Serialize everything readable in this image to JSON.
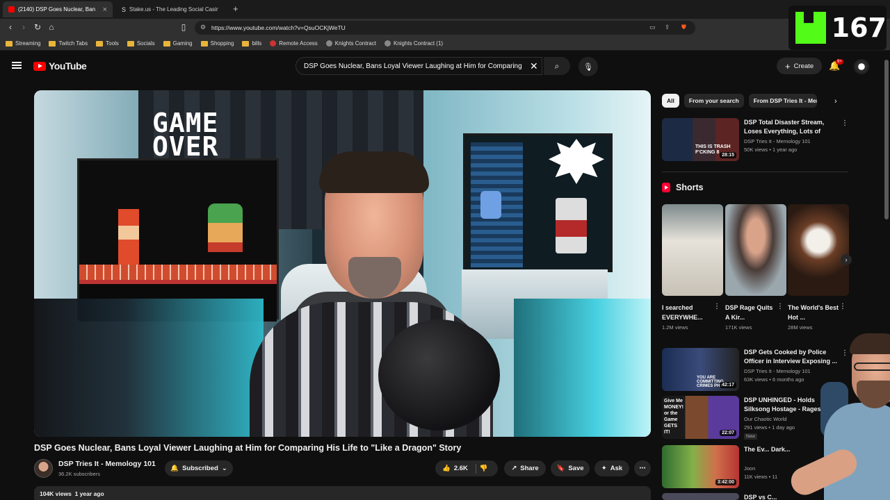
{
  "browser": {
    "tabs": [
      {
        "label": "(2140) DSP Goes Nuclear, Ban",
        "active": true
      },
      {
        "label": "Stake.us - The Leading Social Casino",
        "active": false
      }
    ],
    "url": "https://www.youtube.com/watch?v=QsuOCKjWeTU",
    "bookmarks": [
      "Streaming",
      "Twitch Tabs",
      "Tools",
      "Socials",
      "Gaming",
      "Shopping",
      "bills",
      "Remote Access",
      "Knights Contract",
      "Knights Contract (1)"
    ]
  },
  "kick_overlay": {
    "count": "167"
  },
  "header": {
    "logo_text": "YouTube",
    "search_query": "DSP Goes Nuclear, Bans Loyal Viewer Laughing at Him for Comparing",
    "create_label": "Create",
    "notif_badge": "9+"
  },
  "video": {
    "thumbnail_text": "GAME\nOVER",
    "title": "DSP Goes Nuclear, Bans Loyal Viewer Laughing at Him for Comparing His Life to \"Like a Dragon\" Story",
    "channel": "DSP Tries It - Memology 101",
    "subscribers": "36.2K subscribers",
    "subscribed_label": "Subscribed",
    "likes": "2.6K",
    "share_label": "Share",
    "save_label": "Save",
    "ask_label": "Ask",
    "views": "104K views",
    "age": "1 year ago"
  },
  "chips": [
    "All",
    "From your search",
    "From DSP Tries It - Mem"
  ],
  "recommendations_top": [
    {
      "title": "DSP Total Disaster Stream, Loses Everything, Lots of Troll...",
      "channel": "DSP Tries It - Memology 101",
      "meta": "50K views • 1 year ago",
      "duration": "28:15",
      "thumb_text": "THIS IS TRASH F'CKING 8"
    }
  ],
  "shorts": {
    "heading": "Shorts",
    "items": [
      {
        "title": "I searched EVERYWHE...",
        "views": "1.2M views"
      },
      {
        "title": "DSP Rage Quits A Kir...",
        "views": "171K views"
      },
      {
        "title": "The World's Best Hot ...",
        "views": "28M views"
      }
    ]
  },
  "recommendations": [
    {
      "title": "DSP Gets Cooked by Police Officer in Interview Exposing ...",
      "channel": "DSP Tries It - Memology 101",
      "meta": "63K views • 6 months ago",
      "duration": "42:17",
      "badge": "",
      "thumb_text": "YOU ARE COMMITTING CRIMES PHIL"
    },
    {
      "title": "DSP UNHINGED - Holds Silksong Hostage - Rages, B...",
      "channel": "Our Chaotic World",
      "meta": "291 views • 1 day ago",
      "duration": "22:07",
      "badge": "New",
      "thumb_text": "Give Me MONEY! or the Game GETS IT!"
    },
    {
      "title": "The Ev... Dark...",
      "channel": "Joon",
      "meta": "11K views • 11",
      "duration": "3:42:00",
      "badge": "",
      "thumb_text": ""
    },
    {
      "title": "DSP vs C...",
      "channel": "",
      "meta": "",
      "duration": "",
      "badge": "",
      "thumb_text": ""
    }
  ]
}
